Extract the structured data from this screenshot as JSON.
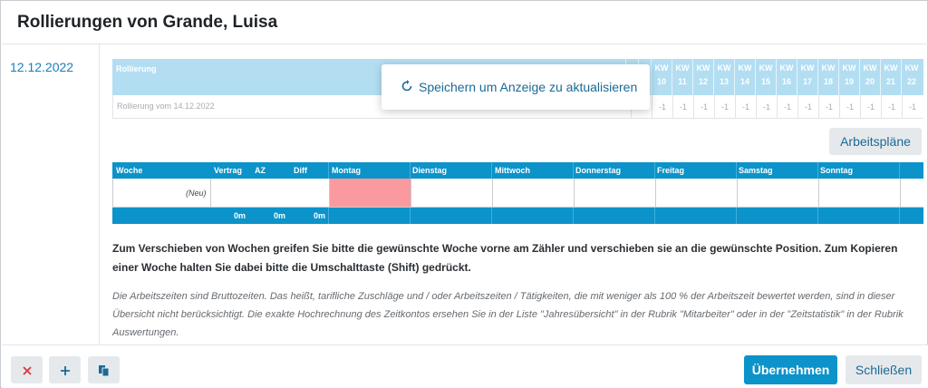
{
  "dialog": {
    "title": "Rollierungen von Grande, Luisa"
  },
  "sidebar": {
    "date": "12.12.2022"
  },
  "rollierung": {
    "header": "Rollierung",
    "kw_label": "KW",
    "weeks": [
      "10",
      "11",
      "12",
      "13",
      "14",
      "15",
      "16",
      "17",
      "18",
      "19",
      "20",
      "21",
      "22"
    ],
    "row_label": "Rollierung vom 14.12.2022",
    "row_values": [
      "-1",
      "-1",
      "-1",
      "-1",
      "-1",
      "-1",
      "-1",
      "-1",
      "-1",
      "-1",
      "-1",
      "-1",
      "-1",
      "-1"
    ]
  },
  "popup": {
    "text": "Speichern um Anzeige zu aktualisieren",
    "icon": "refresh-icon"
  },
  "buttons": {
    "arbeitsplaene": "Arbeitspläne",
    "uebernehmen": "Übernehmen",
    "schliessen": "Schließen"
  },
  "weektable": {
    "headers": {
      "woche": "Woche",
      "vertrag": "Vertrag",
      "az": "AZ",
      "diff": "Diff",
      "montag": "Montag",
      "dienstag": "Dienstag",
      "mittwoch": "Mittwoch",
      "donnerstag": "Donnerstag",
      "freitag": "Freitag",
      "samstag": "Samstag",
      "sonntag": "Sonntag"
    },
    "row_label": "(Neu)",
    "totals": {
      "vertrag": "0m",
      "az": "0m",
      "diff": "0m"
    },
    "highlight_color": "#fb9a9e"
  },
  "texts": {
    "instruction": "Zum Verschieben von Wochen greifen Sie bitte die gewünschte Woche vorne am Zähler und verschieben sie an die gewünschte Position. Zum Kopieren einer Woche halten Sie dabei bitte die Umschalttaste (Shift) gedrückt.",
    "note": "Die Arbeitszeiten sind Bruttozeiten. Das heißt, tarifliche Zuschläge und / oder Arbeitszeiten / Tätigkeiten, die mit weniger als 100 % der Arbeitszeit bewertet werden, sind in dieser Übersicht nicht berücksichtigt. Die exakte Hochrechnung des Zeitkontos ersehen Sie in der Liste \"Jahresübersicht\" in der Rubrik \"Mitarbeiter\" oder in der \"Zeitstatistik\" in der Rubrik Auswertungen."
  },
  "footer_icons": {
    "delete": "close-icon",
    "add": "plus-icon",
    "copy": "copy-icon"
  },
  "colors": {
    "accent": "#0c93c9",
    "link": "#1a6a96",
    "delete": "#d9363e"
  }
}
